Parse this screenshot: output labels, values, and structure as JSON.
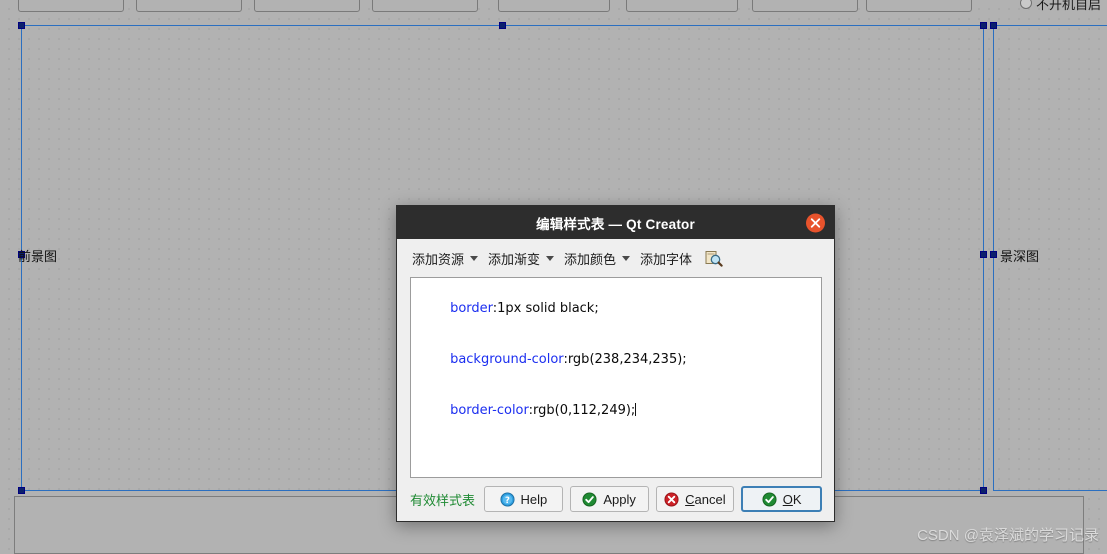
{
  "canvas": {
    "top_widgets_count": 8,
    "radio": {
      "label": "不开机自启",
      "checked": false
    },
    "left_label": "前景图",
    "right_label": "景深图",
    "watermark": "CSDN @袁泽斌的学习记录"
  },
  "dialog": {
    "title": "编辑样式表 — Qt Creator",
    "close_icon": "close-icon",
    "toolbar": {
      "add_resource": "添加资源",
      "add_gradient": "添加渐变",
      "add_color": "添加颜色",
      "add_font": "添加字体",
      "magnifier_icon": "magnifier-icon"
    },
    "editor": {
      "lines": [
        {
          "prop": "border",
          "val": ":1px solid black;"
        },
        {
          "prop": "background-color",
          "val": ":rgb(238,234,235);"
        },
        {
          "prop": "border-color",
          "val": ":rgb(0,112,249);"
        }
      ],
      "full_text": "border:1px solid black;\nbackground-color:rgb(238,234,235);\nborder-color:rgb(0,112,249);"
    },
    "footer": {
      "valid_label": "有效样式表",
      "help": "Help",
      "apply": "Apply",
      "cancel_pre": "",
      "cancel_mnemonic": "C",
      "cancel_post": "ancel",
      "ok_mnemonic": "O",
      "ok_post": "K"
    }
  },
  "colors": {
    "titlebar_bg": "#2d2d2d",
    "close_btn": "#e8532c",
    "dialog_bg": "#efefef",
    "editor_bg": "#ffffff",
    "property_blue": "#1b2ef0",
    "valid_green": "#1f8a33",
    "selection_blue": "#2b6fc0",
    "handle_navy": "#0b1f6b",
    "canvas_gray": "#b2b2b2",
    "default_btn_border": "#3d7fb5"
  }
}
